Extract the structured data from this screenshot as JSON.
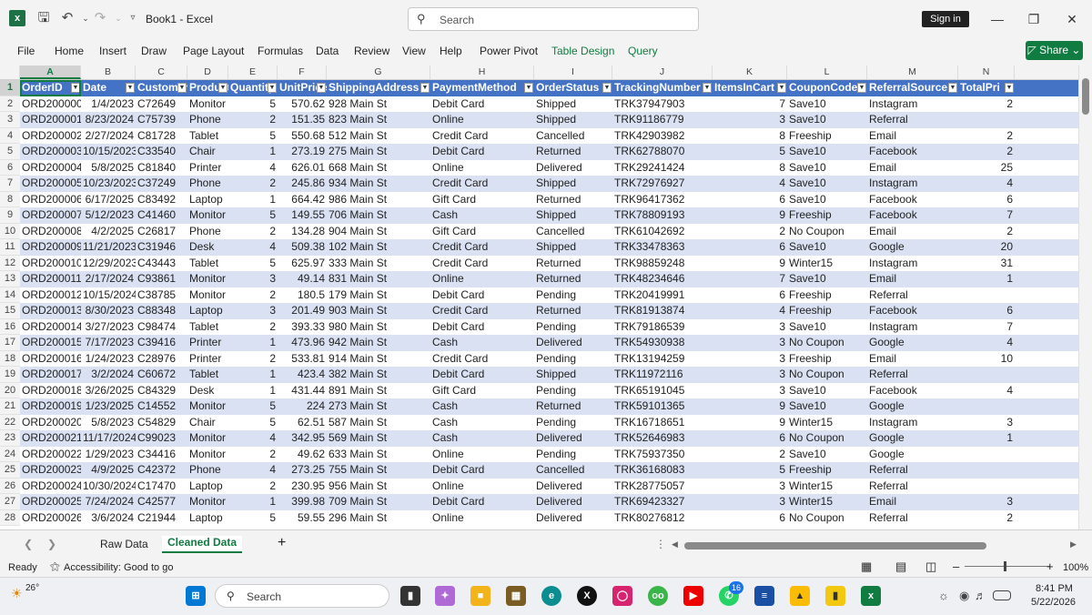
{
  "titlebar": {
    "doc_title": "Book1 - Excel",
    "search_placeholder": "Search",
    "signin_label": "Sign in"
  },
  "ribbon_tabs": [
    "File",
    "Home",
    "Insert",
    "Draw",
    "Page Layout",
    "Formulas",
    "Data",
    "Review",
    "View",
    "Help",
    "Power Pivot",
    "Table Design",
    "Query"
  ],
  "share_label": "Share",
  "columns": [
    "A",
    "B",
    "C",
    "D",
    "E",
    "F",
    "G",
    "H",
    "I",
    "J",
    "K",
    "L",
    "M",
    "N"
  ],
  "headers": [
    "OrderID",
    "Date",
    "CustomerID",
    "Product",
    "Quantity",
    "UnitPrice",
    "ShippingAddress",
    "PaymentMethod",
    "OrderStatus",
    "TrackingNumber",
    "ItemsInCart",
    "CouponCode",
    "ReferralSource",
    "TotalPri"
  ],
  "rows": [
    [
      "ORD200000",
      "1/4/2023",
      "C72649",
      "Monitor",
      "5",
      "570.62",
      "928 Main St",
      "Debit Card",
      "Shipped",
      "TRK37947903",
      "7",
      "Save10",
      "Instagram",
      "2"
    ],
    [
      "ORD200001",
      "8/23/2024",
      "C75739",
      "Phone",
      "2",
      "151.35",
      "823 Main St",
      "Online",
      "Shipped",
      "TRK91186779",
      "3",
      "Save10",
      "Referral",
      ""
    ],
    [
      "ORD200002",
      "2/27/2024",
      "C81728",
      "Tablet",
      "5",
      "550.68",
      "512 Main St",
      "Credit Card",
      "Cancelled",
      "TRK42903982",
      "8",
      "Freeship",
      "Email",
      "2"
    ],
    [
      "ORD200003",
      "10/15/2023",
      "C33540",
      "Chair",
      "1",
      "273.19",
      "275 Main St",
      "Debit Card",
      "Returned",
      "TRK62788070",
      "5",
      "Save10",
      "Facebook",
      "2"
    ],
    [
      "ORD200004",
      "5/8/2025",
      "C81840",
      "Printer",
      "4",
      "626.01",
      "668 Main St",
      "Online",
      "Delivered",
      "TRK29241424",
      "8",
      "Save10",
      "Email",
      "25"
    ],
    [
      "ORD200005",
      "10/23/2023",
      "C37249",
      "Phone",
      "2",
      "245.86",
      "934 Main St",
      "Credit Card",
      "Shipped",
      "TRK72976927",
      "4",
      "Save10",
      "Instagram",
      "4"
    ],
    [
      "ORD200006",
      "6/17/2025",
      "C83492",
      "Laptop",
      "1",
      "664.42",
      "986 Main St",
      "Gift Card",
      "Returned",
      "TRK96417362",
      "6",
      "Save10",
      "Facebook",
      "6"
    ],
    [
      "ORD200007",
      "5/12/2023",
      "C41460",
      "Monitor",
      "5",
      "149.55",
      "706 Main St",
      "Cash",
      "Shipped",
      "TRK78809193",
      "9",
      "Freeship",
      "Facebook",
      "7"
    ],
    [
      "ORD200008",
      "4/2/2025",
      "C26817",
      "Phone",
      "2",
      "134.28",
      "904 Main St",
      "Gift Card",
      "Cancelled",
      "TRK61042692",
      "2",
      "No Coupon",
      "Email",
      "2"
    ],
    [
      "ORD200009",
      "11/21/2023",
      "C31946",
      "Desk",
      "4",
      "509.38",
      "102 Main St",
      "Credit Card",
      "Shipped",
      "TRK33478363",
      "6",
      "Save10",
      "Google",
      "20"
    ],
    [
      "ORD200010",
      "12/29/2023",
      "C43443",
      "Tablet",
      "5",
      "625.97",
      "333 Main St",
      "Credit Card",
      "Returned",
      "TRK98859248",
      "9",
      "Winter15",
      "Instagram",
      "31"
    ],
    [
      "ORD200011",
      "2/17/2024",
      "C93861",
      "Monitor",
      "3",
      "49.14",
      "831 Main St",
      "Online",
      "Returned",
      "TRK48234646",
      "7",
      "Save10",
      "Email",
      "1"
    ],
    [
      "ORD200012",
      "10/15/2024",
      "C38785",
      "Monitor",
      "2",
      "180.5",
      "179 Main St",
      "Debit Card",
      "Pending",
      "TRK20419991",
      "6",
      "Freeship",
      "Referral",
      ""
    ],
    [
      "ORD200013",
      "8/30/2023",
      "C88348",
      "Laptop",
      "3",
      "201.49",
      "903 Main St",
      "Credit Card",
      "Returned",
      "TRK81913874",
      "4",
      "Freeship",
      "Facebook",
      "6"
    ],
    [
      "ORD200014",
      "3/27/2023",
      "C98474",
      "Tablet",
      "2",
      "393.33",
      "980 Main St",
      "Debit Card",
      "Pending",
      "TRK79186539",
      "3",
      "Save10",
      "Instagram",
      "7"
    ],
    [
      "ORD200015",
      "7/17/2023",
      "C39416",
      "Printer",
      "1",
      "473.96",
      "942 Main St",
      "Cash",
      "Delivered",
      "TRK54930938",
      "3",
      "No Coupon",
      "Google",
      "4"
    ],
    [
      "ORD200016",
      "1/24/2023",
      "C28976",
      "Printer",
      "2",
      "533.81",
      "914 Main St",
      "Credit Card",
      "Pending",
      "TRK13194259",
      "3",
      "Freeship",
      "Email",
      "10"
    ],
    [
      "ORD200017",
      "3/2/2024",
      "C60672",
      "Tablet",
      "1",
      "423.4",
      "382 Main St",
      "Debit Card",
      "Shipped",
      "TRK11972116",
      "3",
      "No Coupon",
      "Referral",
      ""
    ],
    [
      "ORD200018",
      "3/26/2025",
      "C84329",
      "Desk",
      "1",
      "431.44",
      "891 Main St",
      "Gift Card",
      "Pending",
      "TRK65191045",
      "3",
      "Save10",
      "Facebook",
      "4"
    ],
    [
      "ORD200019",
      "1/23/2025",
      "C14552",
      "Monitor",
      "5",
      "224",
      "273 Main St",
      "Cash",
      "Returned",
      "TRK59101365",
      "9",
      "Save10",
      "Google",
      ""
    ],
    [
      "ORD200020",
      "5/8/2023",
      "C54829",
      "Chair",
      "5",
      "62.51",
      "587 Main St",
      "Cash",
      "Pending",
      "TRK16718651",
      "9",
      "Winter15",
      "Instagram",
      "3"
    ],
    [
      "ORD200021",
      "11/17/2024",
      "C99023",
      "Monitor",
      "4",
      "342.95",
      "569 Main St",
      "Cash",
      "Delivered",
      "TRK52646983",
      "6",
      "No Coupon",
      "Google",
      "1"
    ],
    [
      "ORD200022",
      "1/29/2023",
      "C34416",
      "Monitor",
      "2",
      "49.62",
      "633 Main St",
      "Online",
      "Pending",
      "TRK75937350",
      "2",
      "Save10",
      "Google",
      ""
    ],
    [
      "ORD200023",
      "4/9/2025",
      "C42372",
      "Phone",
      "4",
      "273.25",
      "755 Main St",
      "Debit Card",
      "Cancelled",
      "TRK36168083",
      "5",
      "Freeship",
      "Referral",
      ""
    ],
    [
      "ORD200024",
      "10/30/2024",
      "C17470",
      "Laptop",
      "2",
      "230.95",
      "956 Main St",
      "Online",
      "Delivered",
      "TRK28775057",
      "3",
      "Winter15",
      "Referral",
      ""
    ],
    [
      "ORD200025",
      "7/24/2024",
      "C42577",
      "Monitor",
      "1",
      "399.98",
      "709 Main St",
      "Debit Card",
      "Delivered",
      "TRK69423327",
      "3",
      "Winter15",
      "Email",
      "3"
    ],
    [
      "ORD200026",
      "3/6/2024",
      "C21944",
      "Laptop",
      "5",
      "59.55",
      "296 Main St",
      "Online",
      "Delivered",
      "TRK80276812",
      "6",
      "No Coupon",
      "Referral",
      "2"
    ]
  ],
  "sheet_tabs": [
    "Raw Data",
    "Cleaned Data"
  ],
  "active_sheet": "Cleaned Data",
  "status": {
    "ready": "Ready",
    "accessibility": "Accessibility: Good to go",
    "zoom": "100%"
  },
  "taskbar": {
    "weather": "26°",
    "search_label": "Search",
    "badge": "16",
    "time": "8:41 PM",
    "date": "5/22/2026"
  }
}
